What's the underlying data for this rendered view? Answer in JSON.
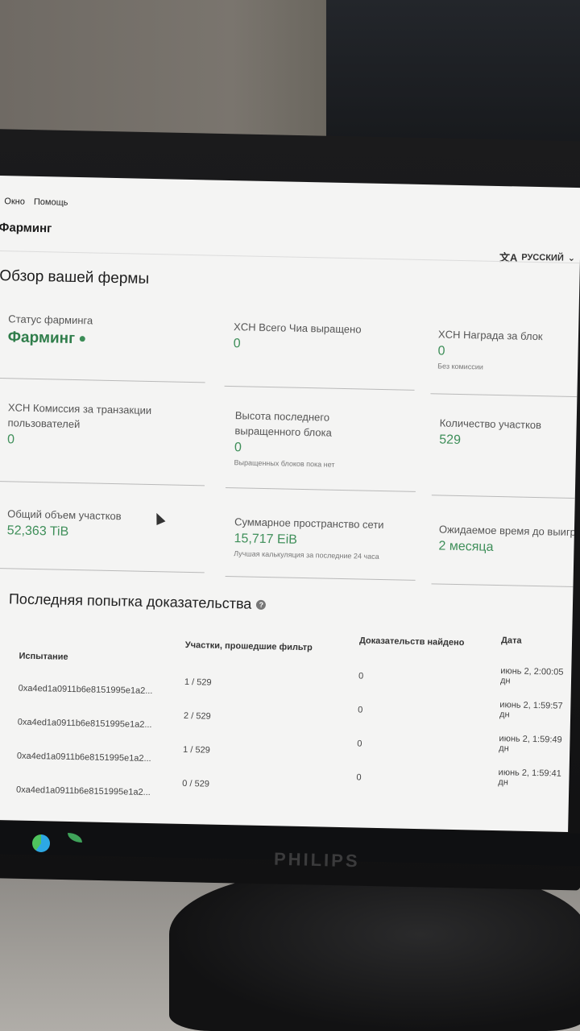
{
  "menu": [
    "Окно",
    "Помощь"
  ],
  "page_title": "Фарминг",
  "language": {
    "label": "РУССКИЙ",
    "icon": "translate-icon",
    "chevron": "chevron-down-icon"
  },
  "overview_title": "Обзор вашей фермы",
  "cards": [
    {
      "label": "Статус фарминга",
      "value": "Фарминг",
      "sub": ""
    },
    {
      "label": "XCH Всего Чиа выращено",
      "value": "0",
      "sub": ""
    },
    {
      "label": "XCH Награда за блок",
      "value": "0",
      "sub": "Без комиссии"
    },
    {
      "label": "XCH Комиссия за транзакции пользователей",
      "value": "0",
      "sub": ""
    },
    {
      "label": "Высота последнего выращенного блока",
      "value": "0",
      "sub": "Выращенных блоков пока нет"
    },
    {
      "label": "Количество участков",
      "value": "529",
      "sub": ""
    },
    {
      "label": "Общий объем участков",
      "value": "52,363 TiB",
      "sub": ""
    },
    {
      "label": "Суммарное пространство сети",
      "value": "15,717 EiB",
      "sub": "Лучшая калькуляция за последние 24 часа"
    },
    {
      "label": "Ожидаемое время до выигрыш",
      "value": "2 месяца",
      "sub": ""
    }
  ],
  "proof": {
    "title": "Последняя попытка доказательства",
    "columns": [
      "Испытание",
      "Участки, прошедшие фильтр",
      "Доказательств найдено",
      "Дата"
    ],
    "rows": [
      {
        "challenge": "0xa4ed1a0911b6e8151995e1a2...",
        "plots": "1 / 529",
        "proofs": "0",
        "date": "июнь 2, 2:00:05 дн"
      },
      {
        "challenge": "0xa4ed1a0911b6e8151995e1a2...",
        "plots": "2 / 529",
        "proofs": "0",
        "date": "июнь 2, 1:59:57 дн"
      },
      {
        "challenge": "0xa4ed1a0911b6e8151995e1a2...",
        "plots": "1 / 529",
        "proofs": "0",
        "date": "июнь 2, 1:59:49 дн"
      },
      {
        "challenge": "0xa4ed1a0911b6e8151995e1a2...",
        "plots": "0 / 529",
        "proofs": "0",
        "date": "июнь 2, 1:59:41 дн"
      }
    ]
  },
  "monitor_brand": "PHILIPS",
  "colors": {
    "accent": "#3f8f5a",
    "screen_bg": "#f4f4f3"
  }
}
